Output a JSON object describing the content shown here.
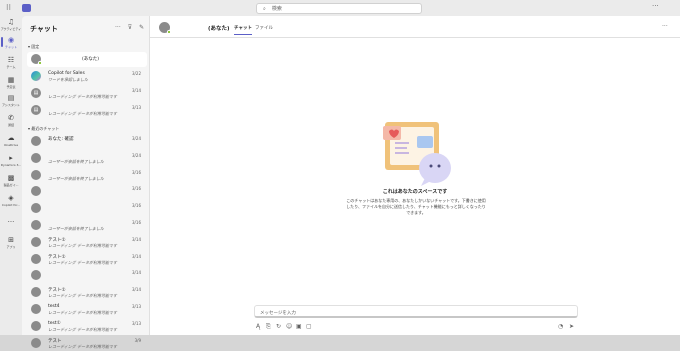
{
  "titlebar": {
    "search_placeholder": "検索",
    "more": "···"
  },
  "rail": [
    {
      "label": "アクティビティ",
      "icon": "bell-icon",
      "glyph": "♫"
    },
    {
      "label": "チャット",
      "icon": "chat-icon",
      "glyph": "◉"
    },
    {
      "label": "チーム",
      "icon": "teams-icon",
      "glyph": "☷"
    },
    {
      "label": "予定表",
      "icon": "calendar-icon",
      "glyph": "▦"
    },
    {
      "label": "アシスタント",
      "icon": "assistant-icon",
      "glyph": "▤"
    },
    {
      "label": "通話",
      "icon": "phone-icon",
      "glyph": "✆"
    },
    {
      "label": "OneDrive",
      "icon": "cloud-icon",
      "glyph": "☁"
    },
    {
      "label": "Dynamics 3...",
      "icon": "dynamics-icon",
      "glyph": "▸"
    },
    {
      "label": "製品ガイ...",
      "icon": "guide-icon",
      "glyph": "▩"
    },
    {
      "label": "Copilot for...",
      "icon": "copilot-app-icon",
      "glyph": "◈"
    },
    {
      "label": "",
      "icon": "more-apps-icon",
      "glyph": "···"
    },
    {
      "label": "アプリ",
      "icon": "apps-icon",
      "glyph": "⊞"
    }
  ],
  "chatlist": {
    "title": "チャット",
    "actions": {
      "more": "···",
      "filter": "⊽",
      "new": "✎"
    },
    "pinned_label": "▾ 固定",
    "recent_label": "▾ 最近のチャット",
    "pinned": [
      {
        "name": "(あなた)",
        "sub": "",
        "date": "",
        "type": "self"
      },
      {
        "name": "Copilot for Sales",
        "sub": "ワードを承認しました",
        "date": "3/22",
        "type": "copilot"
      },
      {
        "name": "",
        "sub": "レコーディング データが利用可能です",
        "date": "3/14",
        "type": "meeting"
      },
      {
        "name": "",
        "sub": "レコーディング データが利用可能です",
        "date": "3/13",
        "type": "meeting"
      }
    ],
    "recent": [
      {
        "name": "あなた: 確認",
        "sub": "",
        "date": "3/24"
      },
      {
        "name": "",
        "sub": "ユーザーが会話を終了しました",
        "date": "3/24"
      },
      {
        "name": "",
        "sub": "ユーザーが会話を終了しました",
        "date": "3/16"
      },
      {
        "name": "",
        "sub": "",
        "date": "3/16"
      },
      {
        "name": "",
        "sub": "",
        "date": "3/16"
      },
      {
        "name": "",
        "sub": "ユーザーが会話を終了しました",
        "date": "3/16"
      },
      {
        "name": "テスト①",
        "sub": "レコーディング データが利用可能です",
        "date": "3/14"
      },
      {
        "name": "テスト①",
        "sub": "レコーディング データが利用可能です",
        "date": "3/14"
      },
      {
        "name": "",
        "sub": "",
        "date": "3/14"
      },
      {
        "name": "テスト①",
        "sub": "レコーディング データが利用可能です",
        "date": "3/14"
      },
      {
        "name": "test4",
        "sub": "レコーディング データが利用可能です",
        "date": "3/13"
      },
      {
        "name": "test①",
        "sub": "レコーディング データが利用可能です",
        "date": "3/13"
      },
      {
        "name": "テスト",
        "sub": "レコーディング データが利用可能です",
        "date": "3/9"
      }
    ]
  },
  "main": {
    "title": "(あなた)",
    "tabs": [
      "チャット",
      "ファイル"
    ],
    "more": "···",
    "empty_title": "これはあなたのスペースです",
    "empty_desc": "このチャットはあなた専用の、あなたしかいないチャットです。下書きに使用したり、ファイルを自分に送信したり、チャット機能にもっと詳しくなったりできます。",
    "compose_placeholder": "メッセージを入力",
    "tools": [
      {
        "icon": "format-icon",
        "glyph": "Ą"
      },
      {
        "icon": "attach-icon",
        "glyph": "⎘"
      },
      {
        "icon": "loop-icon",
        "glyph": "↻"
      },
      {
        "icon": "emoji-icon",
        "glyph": "☺"
      },
      {
        "icon": "gif-icon",
        "glyph": "▣"
      },
      {
        "icon": "sticker-icon",
        "glyph": "▢"
      }
    ],
    "send_tools": [
      {
        "icon": "schedule-icon",
        "glyph": "◔"
      },
      {
        "icon": "send-icon",
        "glyph": "➤"
      }
    ]
  },
  "colors": {
    "accent": "#5b5fc7",
    "presence": "#6bb700"
  }
}
